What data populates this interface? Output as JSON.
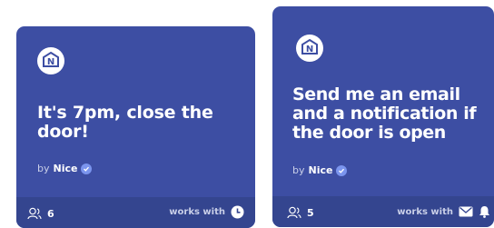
{
  "cards": [
    {
      "title": "It's 7pm, close the door!",
      "by": "by",
      "author": "Nice",
      "users": "6",
      "works_with": "works with",
      "services": [
        "clock-icon"
      ]
    },
    {
      "title": "Send me an email and a notification if the door is open",
      "by": "by",
      "author": "Nice",
      "users": "5",
      "works_with": "works with",
      "services": [
        "email-icon",
        "notification-icon"
      ]
    }
  ],
  "colors": {
    "card_bg": "#3d4ea3",
    "footer_bg": "#34458f",
    "verified": "#7b95ee"
  }
}
